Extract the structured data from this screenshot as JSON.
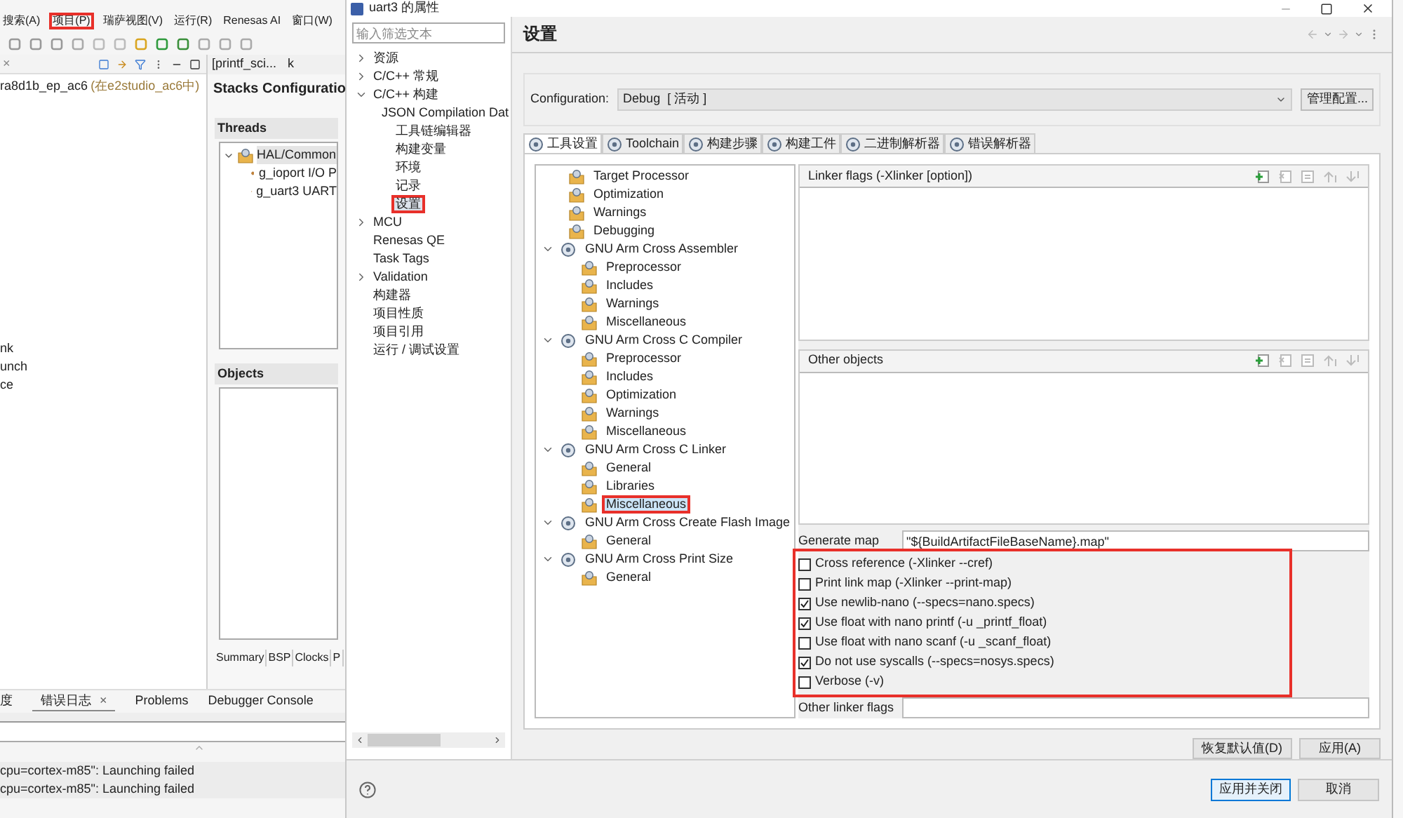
{
  "ide": {
    "menu": [
      {
        "label": "搜索(A)",
        "annotated": false
      },
      {
        "label": "项目(P)",
        "annotated": true
      },
      {
        "label": "瑞萨视图(V)",
        "annotated": false
      },
      {
        "label": "运行(R)",
        "annotated": false
      },
      {
        "label": "Renesas AI",
        "annotated": false
      },
      {
        "label": "窗口(W)",
        "annotated": false
      }
    ],
    "explorer": {
      "close": "×",
      "project": "ra8d1b_ep_ac6",
      "location": "(在e2studio_ac6中)",
      "items": [
        "nk",
        "unch",
        "ce"
      ]
    },
    "editor": {
      "tabs": [
        "[printf_sci...",
        "k"
      ],
      "title": "Stacks Configuratio",
      "threads_title": "Threads",
      "threads": [
        {
          "label": "HAL/Common",
          "children": [
            {
              "label": "g_ioport I/O P"
            },
            {
              "label": "g_uart3 UART"
            }
          ]
        }
      ],
      "objects_title": "Objects",
      "bottom_tabs": [
        "Summary",
        "BSP",
        "Clocks",
        "P"
      ]
    },
    "console": {
      "tabs": [
        {
          "label": "度",
          "selected": false
        },
        {
          "label": "错误日志",
          "selected": true,
          "close": "×"
        },
        {
          "label": "Problems",
          "selected": false
        },
        {
          "label": "Debugger Console",
          "selected": false
        }
      ],
      "rows": [
        "cpu=cortex-m85\": Launching failed",
        "cpu=cortex-m85\": Launching failed"
      ]
    }
  },
  "dialog": {
    "title": "uart3 的属性",
    "filter": {
      "placeholder": "输入筛选文本"
    },
    "nav": [
      {
        "label": "资源",
        "expanded": false
      },
      {
        "label": "C/C++ 常规",
        "expanded": false
      },
      {
        "label": "C/C++ 构建",
        "expanded": true,
        "children": [
          {
            "label": "JSON Compilation Dat"
          },
          {
            "label": "工具链编辑器"
          },
          {
            "label": "构建变量"
          },
          {
            "label": "环境"
          },
          {
            "label": "记录"
          },
          {
            "label": "设置",
            "selected": true,
            "annotated": true
          }
        ]
      },
      {
        "label": "MCU",
        "expanded": false
      },
      {
        "label": "Renesas QE"
      },
      {
        "label": "Task Tags"
      },
      {
        "label": "Validation",
        "expanded": false
      },
      {
        "label": "构建器"
      },
      {
        "label": "项目性质"
      },
      {
        "label": "项目引用"
      },
      {
        "label": "运行 / 调试设置"
      }
    ],
    "heading": "设置",
    "configuration_label": "Configuration:",
    "configuration": "Debug  [ 活动 ]",
    "manage_button": "管理配置...",
    "tabs": [
      {
        "label": "工具设置",
        "selected": true
      },
      {
        "label": "Toolchain",
        "selected": false
      },
      {
        "label": "构建步骤",
        "selected": false
      },
      {
        "label": "构建工件",
        "selected": false
      },
      {
        "label": "二进制解析器",
        "selected": false
      },
      {
        "label": "错误解析器",
        "selected": false
      }
    ],
    "tools": [
      {
        "label": "Target Processor"
      },
      {
        "label": "Optimization"
      },
      {
        "label": "Warnings"
      },
      {
        "label": "Debugging"
      },
      {
        "label": "GNU Arm Cross Assembler",
        "expanded": true,
        "children": [
          {
            "label": "Preprocessor"
          },
          {
            "label": "Includes"
          },
          {
            "label": "Warnings"
          },
          {
            "label": "Miscellaneous"
          }
        ]
      },
      {
        "label": "GNU Arm Cross C Compiler",
        "expanded": true,
        "children": [
          {
            "label": "Preprocessor"
          },
          {
            "label": "Includes"
          },
          {
            "label": "Optimization"
          },
          {
            "label": "Warnings"
          },
          {
            "label": "Miscellaneous"
          }
        ]
      },
      {
        "label": "GNU Arm Cross C Linker",
        "expanded": true,
        "children": [
          {
            "label": "General"
          },
          {
            "label": "Libraries"
          },
          {
            "label": "Miscellaneous",
            "selected": true,
            "annotated": true
          }
        ]
      },
      {
        "label": "GNU Arm Cross Create Flash Image",
        "expanded": true,
        "children": [
          {
            "label": "General"
          }
        ]
      },
      {
        "label": "GNU Arm Cross Print Size",
        "expanded": true,
        "children": [
          {
            "label": "General"
          }
        ]
      }
    ],
    "linker_flags_title": "Linker flags (-Xlinker [option])",
    "other_objects_title": "Other objects",
    "generate_map_label": "Generate map",
    "generate_map": "\"${BuildArtifactFileBaseName}.map\"",
    "options_annotated": true,
    "options": [
      {
        "label": "Cross reference (-Xlinker --cref)",
        "checked": false
      },
      {
        "label": "Print link map (-Xlinker --print-map)",
        "checked": false
      },
      {
        "label": "Use newlib-nano (--specs=nano.specs)",
        "checked": true
      },
      {
        "label": "Use float with nano printf (-u _printf_float)",
        "checked": true
      },
      {
        "label": "Use float with nano scanf (-u _scanf_float)",
        "checked": false
      },
      {
        "label": "Do not use syscalls (--specs=nosys.specs)",
        "checked": true
      },
      {
        "label": "Verbose (-v)",
        "checked": false
      }
    ],
    "other_flags_label": "Other linker flags",
    "restore_button": "恢复默认值(D)",
    "apply_button": "应用(A)",
    "apply_close_button": "应用并关闭",
    "cancel_button": "取消"
  }
}
